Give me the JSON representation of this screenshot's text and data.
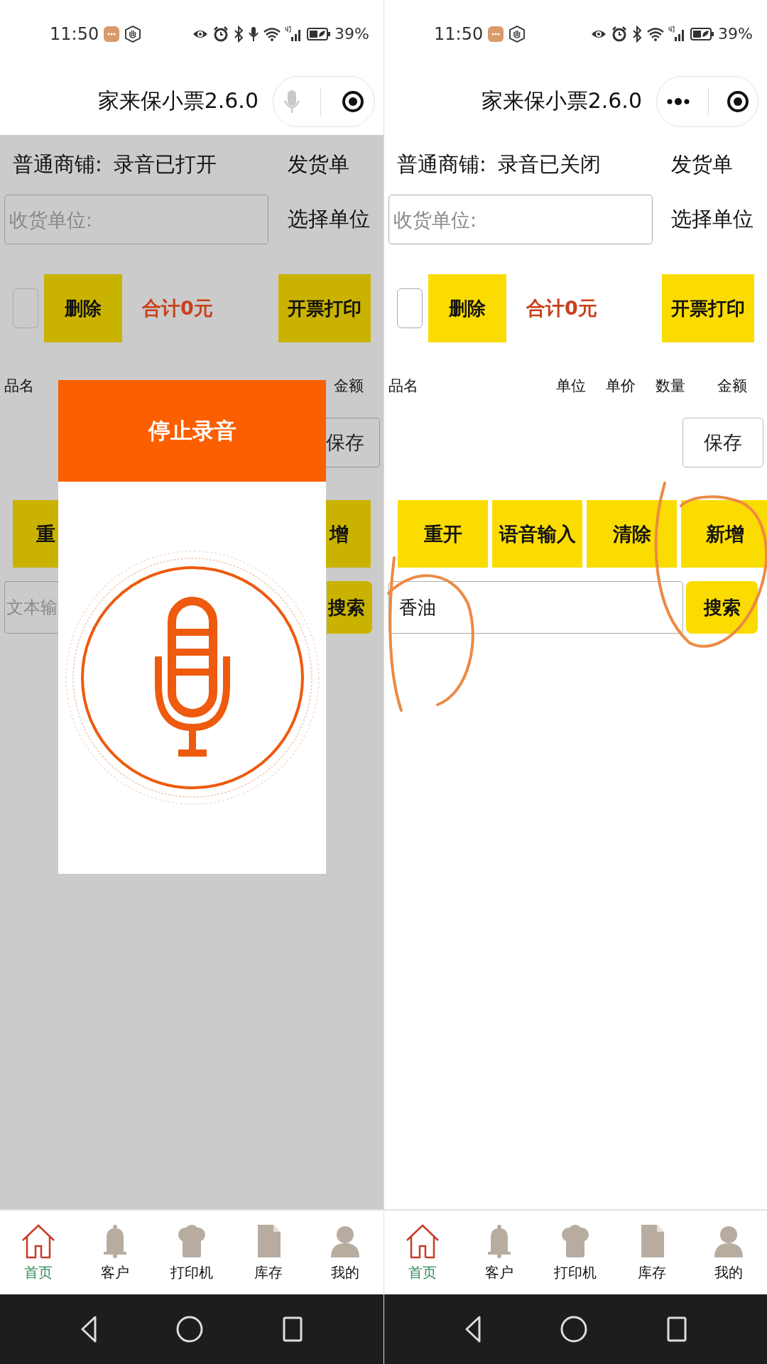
{
  "phones": [
    {
      "status_bar": {
        "time": "11:50",
        "mic_in_use": true,
        "battery": "39%"
      },
      "title": "家来保小票2.6.0",
      "capsule": {
        "recording": true
      },
      "shop_label": "普通商铺:",
      "recording_status": "录音已打开",
      "doc_type": "发货单",
      "consignee_field": {
        "placeholder": "收货单位:"
      },
      "select_unit": "选择单位",
      "select_all": {
        "checked": false
      },
      "delete_button": "删除",
      "total": "合计0元",
      "print_button": "开票打印",
      "columns": [
        "品名",
        "金额"
      ],
      "save_button": "保存",
      "buttons": [
        "重",
        "增"
      ],
      "search_field": {
        "placeholder": "文本输"
      },
      "search_button": "搜索",
      "dialog": {
        "title": "停止录音"
      },
      "tabs": [
        {
          "label": "首页",
          "selected": true
        },
        {
          "label": "客户",
          "selected": false
        },
        {
          "label": "打印机",
          "selected": false
        },
        {
          "label": "库存",
          "selected": false
        },
        {
          "label": "我的",
          "selected": false
        }
      ]
    },
    {
      "status_bar": {
        "time": "11:50",
        "mic_in_use": false,
        "battery": "39%"
      },
      "title": "家来保小票2.6.0",
      "capsule": {
        "recording": false
      },
      "shop_label": "普通商铺:",
      "recording_status": "录音已关闭",
      "doc_type": "发货单",
      "consignee_field": {
        "placeholder": "收货单位:"
      },
      "select_unit": "选择单位",
      "select_all": {
        "checked": false
      },
      "delete_button": "删除",
      "total": "合计0元",
      "print_button": "开票打印",
      "columns": [
        "品名",
        "单位",
        "单价",
        "数量",
        "金额"
      ],
      "save_button": "保存",
      "buttons": [
        "重开",
        "语音输入",
        "清除",
        "新增"
      ],
      "search_field": {
        "value": "香油"
      },
      "search_button": "搜索",
      "annotations": [
        {
          "kind": "circle"
        },
        {
          "kind": "circle"
        }
      ],
      "tabs": [
        {
          "label": "首页",
          "selected": true
        },
        {
          "label": "客户",
          "selected": false
        },
        {
          "label": "打印机",
          "selected": false
        },
        {
          "label": "库存",
          "selected": false
        },
        {
          "label": "我的",
          "selected": false
        }
      ]
    }
  ]
}
